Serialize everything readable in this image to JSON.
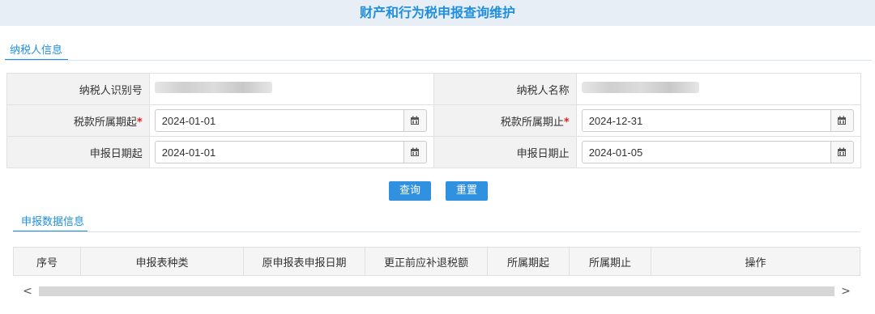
{
  "page_title": "财产和行为税申报查询维护",
  "taxpayer_section": {
    "tab_label": "纳税人信息"
  },
  "form": {
    "taxpayer_id_label": "纳税人识别号",
    "taxpayer_name_label": "纳税人名称",
    "tax_period_start_label": "税款所属期起",
    "tax_period_end_label": "税款所属期止",
    "required_mark": "*",
    "tax_period_start_value": "2024-01-01",
    "tax_period_end_value": "2024-12-31",
    "declare_date_start_label": "申报日期起",
    "declare_date_end_label": "申报日期止",
    "declare_date_start_value": "2024-01-01",
    "declare_date_end_value": "2024-01-05"
  },
  "actions": {
    "query_label": "查询",
    "reset_label": "重置"
  },
  "data_section": {
    "tab_label": "申报数据信息"
  },
  "table": {
    "columns": [
      "序号",
      "申报表种类",
      "原申报表申报日期",
      "更正前应补退税额",
      "所属期起",
      "所属期止",
      "操作"
    ]
  },
  "scrollbar": {
    "left_arrow": "<",
    "right_arrow": ">"
  },
  "icons": {
    "calendar": "calendar-icon"
  },
  "colors": {
    "accent": "#1f8fe0",
    "button": "#2f91e0",
    "required": "#e02020"
  }
}
